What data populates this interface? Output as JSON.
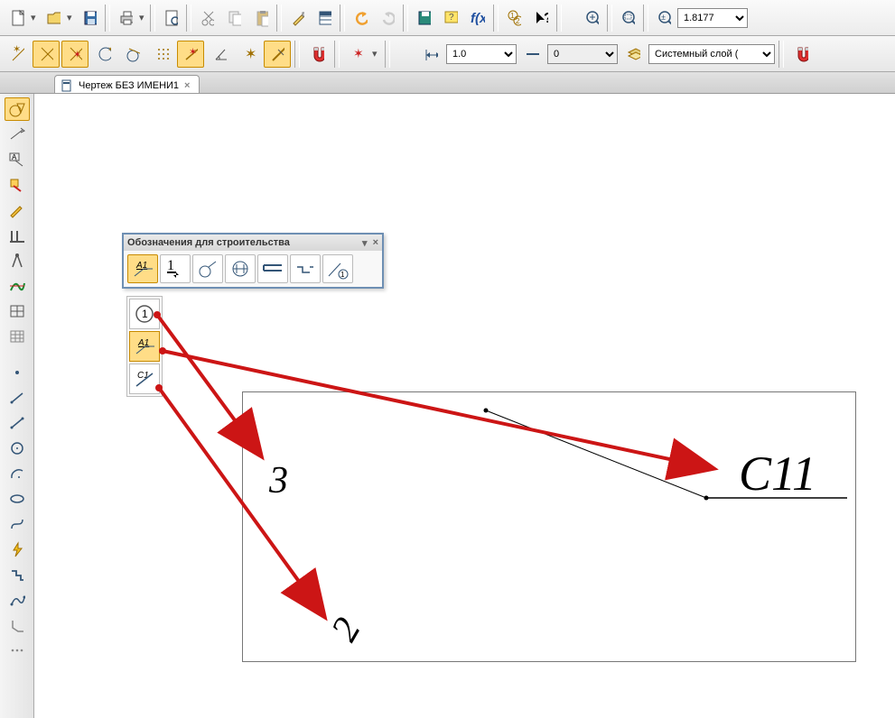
{
  "toolbar1": {
    "zoom_value": "1.8177"
  },
  "toolbar2": {
    "line_weight": "1.0",
    "line_type": "0",
    "layer": "Системный слой ("
  },
  "tab": {
    "title": "Чертеж БЕЗ ИМЕНИ1"
  },
  "float_panel": {
    "title": "Обозначения для строительства"
  },
  "canvas": {
    "label3": "3",
    "label2": "2",
    "label_c11": "С11"
  }
}
